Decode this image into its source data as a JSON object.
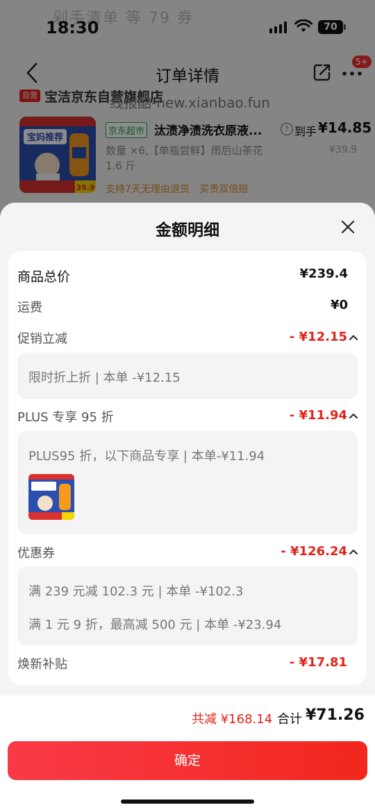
{
  "background": {
    "status_bar": {
      "time": "18:30",
      "battery": "70"
    },
    "ghost_text": "剁手清单 等 79 券",
    "nav": {
      "title": "订单详情",
      "badge": "5+"
    },
    "store": {
      "tag": "自营",
      "name": "宝洁京东自营旗舰店"
    },
    "watermark": "线报酷-new.xianbao.fun",
    "product": {
      "channel_tag": "京东超市",
      "name": "汰渍净渍洗衣原液...",
      "est_label": "到手",
      "est_price": "¥14.85",
      "orig_price": "¥39.9",
      "spec": "数量 ×6,【单瓶尝鲜】雨后山茶花 1.6 斤",
      "services": "支持7天无理由退货 买贵双倍赔",
      "thumb_badge": "宝妈推荐",
      "thumb_price": "39.9"
    }
  },
  "sheet": {
    "title": "金额明细",
    "rows": {
      "goods_total": {
        "label": "商品总价",
        "value": "¥239.4"
      },
      "shipping": {
        "label": "运费",
        "value": "¥0"
      },
      "promo": {
        "label": "促销立减",
        "value": "- ¥12.15",
        "detail": "限时折上折 | 本单 -¥12.15"
      },
      "plus": {
        "label": "PLUS 专享 95 折",
        "value": "- ¥11.94",
        "detail": "PLUS95 折，以下商品专享 | 本单-¥11.94"
      },
      "coupon": {
        "label": "优惠券",
        "value": "- ¥126.24",
        "detail_1": "满 239 元减 102.3 元 | 本单 -¥102.3",
        "detail_2": "满 1 元 9 折，最高减 500 元 | 本单 -¥23.94"
      },
      "renewal": {
        "label": "焕新补贴",
        "value": "- ¥17.81"
      }
    },
    "footer": {
      "total_reduce": "共减 ¥168.14",
      "total_label": "合计",
      "total_price": "¥71.26",
      "confirm": "确定"
    }
  },
  "colors": {
    "accent": "#e2231a",
    "button": "#f2271d"
  }
}
